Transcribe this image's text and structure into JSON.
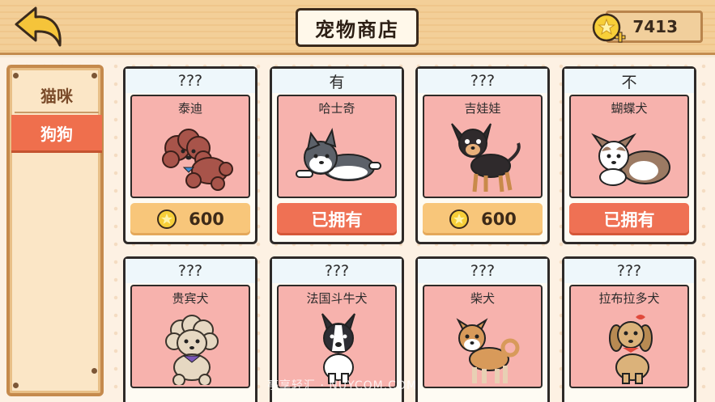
{
  "header": {
    "title": "宠物商店",
    "coins": "7413"
  },
  "sidebar": {
    "tabs": [
      {
        "label": "猫咪",
        "active": false
      },
      {
        "label": "狗狗",
        "active": true
      }
    ]
  },
  "cards": [
    {
      "header": "???",
      "name": "泰迪",
      "button": "600",
      "type": "price",
      "icon": "toy-poodle-icon"
    },
    {
      "header": "有",
      "name": "哈士奇",
      "button": "已拥有",
      "type": "owned",
      "icon": "husky-icon"
    },
    {
      "header": "???",
      "name": "吉娃娃",
      "button": "600",
      "type": "price",
      "icon": "chihuahua-icon"
    },
    {
      "header": "不",
      "name": "蝴蝶犬",
      "button": "已拥有",
      "type": "owned",
      "icon": "papillon-icon"
    },
    {
      "header": "???",
      "name": "贵宾犬",
      "icon": "poodle-icon"
    },
    {
      "header": "???",
      "name": "法国斗牛犬",
      "icon": "french-bulldog-icon"
    },
    {
      "header": "???",
      "name": "柴犬",
      "icon": "shiba-icon"
    },
    {
      "header": "???",
      "name": "拉布拉多犬",
      "icon": "labrador-icon"
    }
  ],
  "watermark": "亭享轻汇 · NUYCOM.COM",
  "colors": {
    "accent": "#ef6f4d",
    "card_bg": "#f7b2ad",
    "price_btn": "#f8c67a"
  }
}
